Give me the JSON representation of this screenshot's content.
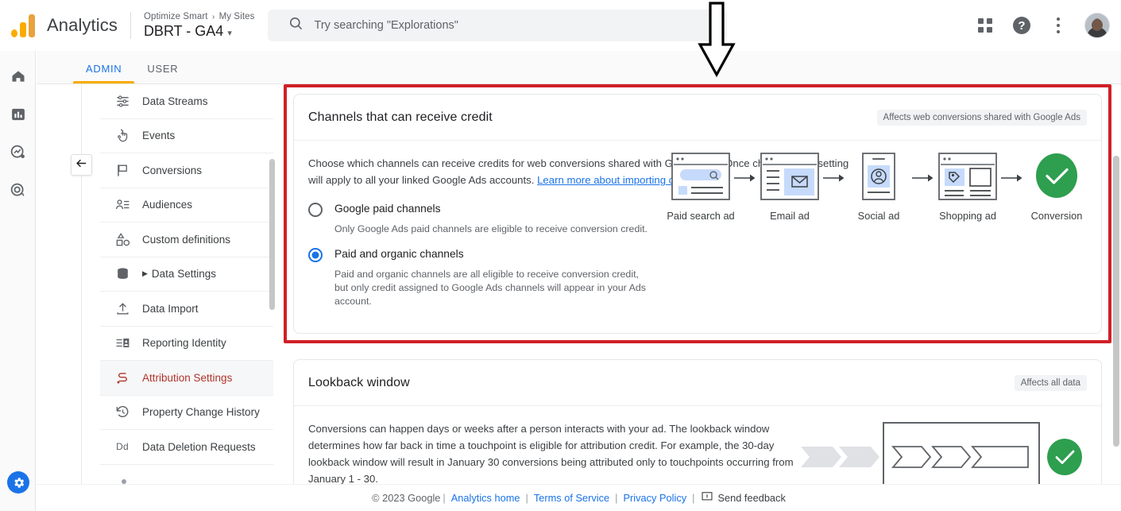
{
  "header": {
    "brand": "Analytics",
    "breadcrumb": {
      "account": "Optimize Smart",
      "separator": "›",
      "site": "My Sites"
    },
    "property_name": "DBRT - GA4",
    "property_caret": "▾",
    "search": {
      "placeholder": "Try searching \"Explorations\"",
      "icon": "search-icon"
    },
    "apps_icon": "grid-apps-icon",
    "help_icon": "help-circle-icon",
    "more_icon": "kebab-more-icon",
    "avatar": "user-avatar"
  },
  "tabs": [
    {
      "label": "ADMIN",
      "active": true
    },
    {
      "label": "USER",
      "active": false
    }
  ],
  "rail": {
    "items": [
      {
        "name": "home-icon",
        "label": "Home"
      },
      {
        "name": "reports-bar-chart-icon",
        "label": "Reports"
      },
      {
        "name": "explore-icon",
        "label": "Explore"
      },
      {
        "name": "advertising-target-icon",
        "label": "Advertising"
      }
    ],
    "settings_fab": "gear-icon"
  },
  "collapse_button": {
    "icon": "arrow-left-icon",
    "label": "Collapse menu"
  },
  "subnav": {
    "items": [
      {
        "label": "Data Streams",
        "icon": "data-streams-icon",
        "selected": false,
        "expandable": false
      },
      {
        "label": "Events",
        "icon": "events-tap-icon",
        "selected": false,
        "expandable": false
      },
      {
        "label": "Conversions",
        "icon": "flag-icon",
        "selected": false,
        "expandable": false
      },
      {
        "label": "Audiences",
        "icon": "audiences-people-icon",
        "selected": false,
        "expandable": false
      },
      {
        "label": "Custom definitions",
        "icon": "custom-definitions-shapes-icon",
        "selected": false,
        "expandable": false
      },
      {
        "label": "Data Settings",
        "icon": "database-icon",
        "selected": false,
        "expandable": true
      },
      {
        "label": "Data Import",
        "icon": "upload-icon",
        "selected": false,
        "expandable": false
      },
      {
        "label": "Reporting Identity",
        "icon": "reporting-identity-icon",
        "selected": false,
        "expandable": false
      },
      {
        "label": "Attribution Settings",
        "icon": "attribution-path-icon",
        "selected": true,
        "expandable": false
      },
      {
        "label": "Property Change History",
        "icon": "history-clock-icon",
        "selected": false,
        "expandable": false
      },
      {
        "label": "Data Deletion Requests",
        "icon": "dd-text-icon",
        "selected": false,
        "expandable": false
      }
    ]
  },
  "channels_card": {
    "title": "Channels that can receive credit",
    "badge": "Affects web conversions shared with Google Ads",
    "description_part1": "Choose which channels can receive credits for web conversions shared with Google Ads. Once changed, this setting will apply to all your linked Google Ads accounts. ",
    "learn_more": "Learn more about importing conversions",
    "options": [
      {
        "label": "Google paid channels",
        "description": "Only Google Ads paid channels are eligible to receive conversion credit.",
        "selected": false
      },
      {
        "label": "Paid and organic channels",
        "description": "Paid and organic channels are all eligible to receive conversion credit, but only credit assigned to Google Ads channels will appear in your Ads account.",
        "selected": true
      }
    ],
    "funnel": {
      "steps": [
        {
          "caption": "Paid search ad",
          "icon": "paid-search-ad-icon"
        },
        {
          "caption": "Email ad",
          "icon": "email-ad-icon"
        },
        {
          "caption": "Social ad",
          "icon": "social-ad-icon"
        },
        {
          "caption": "Shopping ad",
          "icon": "shopping-ad-icon"
        },
        {
          "caption": "Conversion",
          "icon": "conversion-check-icon"
        }
      ],
      "arrow": "→"
    }
  },
  "lookback_card": {
    "title": "Lookback window",
    "badge": "Affects all data",
    "description": "Conversions can happen days or weeks after a person interacts with your ad. The lookback window determines how far back in time a touchpoint is eligible for attribution credit. For example, the 30-day lookback window will result in January 30 conversions being attributed only to touchpoints occurring from January 1 - 30."
  },
  "footer": {
    "copyright": "© 2023 Google",
    "links": [
      "Analytics home",
      "Terms of Service",
      "Privacy Policy"
    ],
    "feedback": "Send feedback",
    "feedback_icon": "feedback-icon",
    "pipe": "|"
  },
  "colors": {
    "accent_blue": "#1a73e8",
    "highlight_red": "#CF2027",
    "selected_nav": "#B0342C",
    "tab_underline": "#F9AB00",
    "conversion_green": "#2E9E4F"
  },
  "annotation": {
    "arrow": "down-arrow-annotation"
  }
}
